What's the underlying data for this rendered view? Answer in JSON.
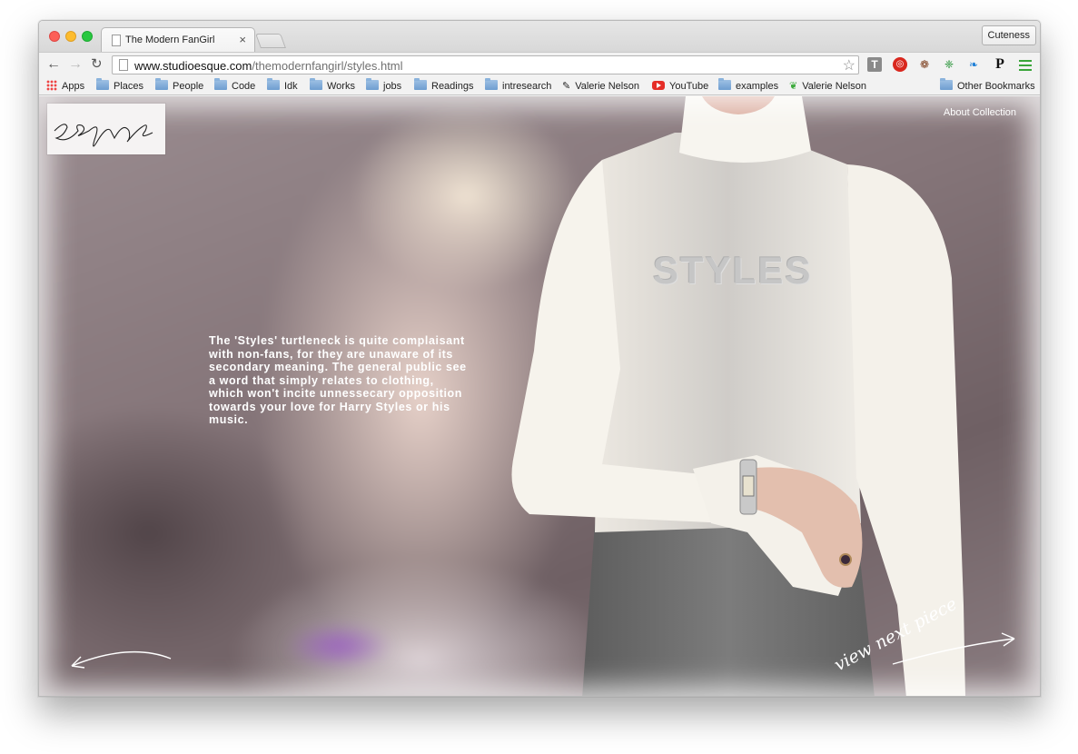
{
  "browser": {
    "tab_title": "The Modern FanGirl",
    "tab_close": "×",
    "profile_label": "Cuteness",
    "url_host": "www.studioesque.com",
    "url_path": "/themodernfangirl/styles.html",
    "extensions": {
      "t_label": "T",
      "p_label": "P"
    },
    "bookmarks": [
      {
        "label": "Apps",
        "icon": "apps-grid-icon"
      },
      {
        "label": "Places",
        "icon": "folder-icon"
      },
      {
        "label": "People",
        "icon": "folder-icon"
      },
      {
        "label": "Code",
        "icon": "folder-icon"
      },
      {
        "label": "Idk",
        "icon": "folder-icon"
      },
      {
        "label": "Works",
        "icon": "folder-icon"
      },
      {
        "label": "jobs",
        "icon": "folder-icon"
      },
      {
        "label": "Readings",
        "icon": "folder-icon"
      },
      {
        "label": "intresearch",
        "icon": "folder-icon"
      },
      {
        "label": "Valerie Nelson",
        "icon": "pen-icon"
      },
      {
        "label": "YouTube",
        "icon": "youtube-icon"
      },
      {
        "label": "examples",
        "icon": "folder-icon"
      },
      {
        "label": "Valerie Nelson",
        "icon": "leaf-icon"
      },
      {
        "label": "Other Bookmarks",
        "icon": "folder-icon"
      }
    ]
  },
  "page": {
    "logo_text": "esque",
    "nav_link": "About Collection",
    "blurb": "The 'Styles' turtleneck is quite complaisant with non-fans, for they are unaware of its secondary meaning. The general public see a word that simply relates to clothing, which won't incite unnessecary opposition towards your love for Harry Styles or his music.",
    "shirt_print": "STYLES",
    "next_label": "view next piece"
  },
  "colors": {
    "accent_text": "#ffffff",
    "shirt": "#f4f1ea",
    "skirt": "#6e6e6e"
  }
}
